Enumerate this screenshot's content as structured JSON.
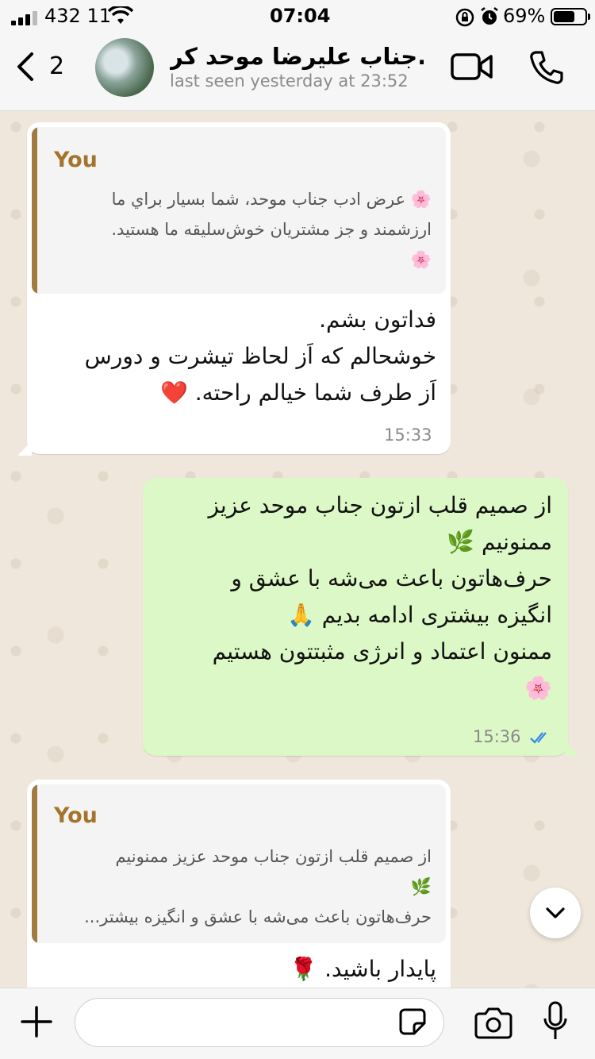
{
  "status_bar": {
    "carrier": "432 11",
    "time": "07:04",
    "battery": "69%"
  },
  "header": {
    "back_count": "2",
    "title": "جناب علیرضا موحد کر...",
    "subtitle": "last seen yesterday at 23:52"
  },
  "messages": [
    {
      "direction": "incoming",
      "quote_author": "You",
      "quote_text": "🌸 عرض ادب جناب موحد، شما بسيار براي ما\nارزشمند و جز مشتريان خوش‌سليقه ما هستيد.\n🌸",
      "text": "فداتون بشم.\nخوشحالم که اَز لحاظ تیشرت و دورس\nاَز طرف شما خیالم راحته. ❤️",
      "time": "15:33"
    },
    {
      "direction": "outgoing",
      "text": "از صمیم قلب ازتون جناب موحد عزیز\nممنونیم 🌿\nحرف‌هاتون باعث می‌شه با عشق و\nانگیزه بیشتری ادامه بدیم 🙏\nممنون اعتماد و انرژی مثبتتون هستیم\n🌸",
      "time": "15:36",
      "status": "read"
    },
    {
      "direction": "incoming",
      "quote_author": "You",
      "quote_text": "از صمیم قلب ازتون جناب موحد عزیز ممنونیم\n🌿\nحرف‌هاتون باعث می‌شه با عشق و انگیزه بیشتر...",
      "text": "پایدار باشید. 🌹"
    }
  ],
  "composer": {
    "placeholder": ""
  },
  "colors": {
    "outgoing_bubble": "#dcf8c6",
    "incoming_bubble": "#ffffff",
    "quote_author": "#a5742c",
    "read_ticks": "#3a8ee6"
  }
}
